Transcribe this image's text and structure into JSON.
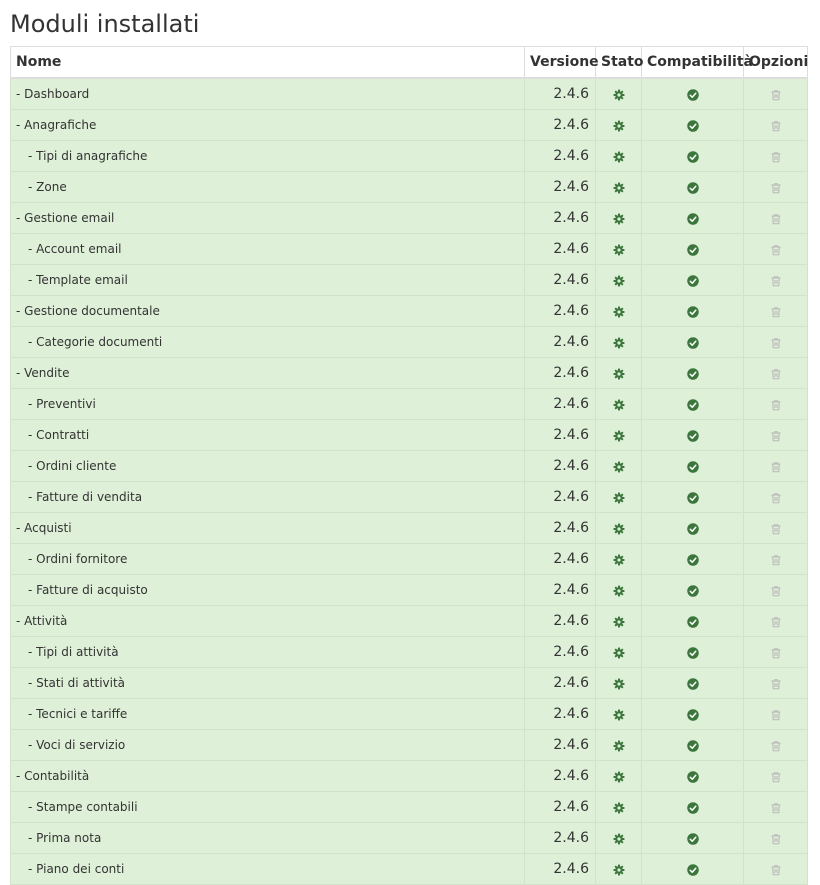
{
  "page": {
    "title": "Moduli installati"
  },
  "table": {
    "headers": {
      "name": "Nome",
      "version": "Versione",
      "status": "Stato",
      "compatibility": "Compatibilità",
      "options": "Opzioni"
    },
    "icons": {
      "status": "gear-icon",
      "compatibility": "check-circle-icon",
      "options": "trash-icon"
    },
    "colors": {
      "row_background": "#dff0d8",
      "icon_green": "#3c763d",
      "trash_gray": "#b9b9b9"
    },
    "rows": [
      {
        "name": "- Dashboard",
        "level": 1,
        "version": "2.4.6"
      },
      {
        "name": "- Anagrafiche",
        "level": 1,
        "version": "2.4.6"
      },
      {
        "name": "- Tipi di anagrafiche",
        "level": 2,
        "version": "2.4.6"
      },
      {
        "name": "- Zone",
        "level": 2,
        "version": "2.4.6"
      },
      {
        "name": "- Gestione email",
        "level": 1,
        "version": "2.4.6"
      },
      {
        "name": "- Account email",
        "level": 2,
        "version": "2.4.6"
      },
      {
        "name": "- Template email",
        "level": 2,
        "version": "2.4.6"
      },
      {
        "name": "- Gestione documentale",
        "level": 1,
        "version": "2.4.6"
      },
      {
        "name": "- Categorie documenti",
        "level": 2,
        "version": "2.4.6"
      },
      {
        "name": "- Vendite",
        "level": 1,
        "version": "2.4.6"
      },
      {
        "name": "- Preventivi",
        "level": 2,
        "version": "2.4.6"
      },
      {
        "name": "- Contratti",
        "level": 2,
        "version": "2.4.6"
      },
      {
        "name": "- Ordini cliente",
        "level": 2,
        "version": "2.4.6"
      },
      {
        "name": "- Fatture di vendita",
        "level": 2,
        "version": "2.4.6"
      },
      {
        "name": "- Acquisti",
        "level": 1,
        "version": "2.4.6"
      },
      {
        "name": "- Ordini fornitore",
        "level": 2,
        "version": "2.4.6"
      },
      {
        "name": "- Fatture di acquisto",
        "level": 2,
        "version": "2.4.6"
      },
      {
        "name": "- Attività",
        "level": 1,
        "version": "2.4.6"
      },
      {
        "name": "- Tipi di attività",
        "level": 2,
        "version": "2.4.6"
      },
      {
        "name": "- Stati di attività",
        "level": 2,
        "version": "2.4.6"
      },
      {
        "name": "- Tecnici e tariffe",
        "level": 2,
        "version": "2.4.6"
      },
      {
        "name": "- Voci di servizio",
        "level": 2,
        "version": "2.4.6"
      },
      {
        "name": "- Contabilità",
        "level": 1,
        "version": "2.4.6"
      },
      {
        "name": "- Stampe contabili",
        "level": 2,
        "version": "2.4.6"
      },
      {
        "name": "- Prima nota",
        "level": 2,
        "version": "2.4.6"
      },
      {
        "name": "- Piano dei conti",
        "level": 2,
        "version": "2.4.6"
      }
    ]
  }
}
